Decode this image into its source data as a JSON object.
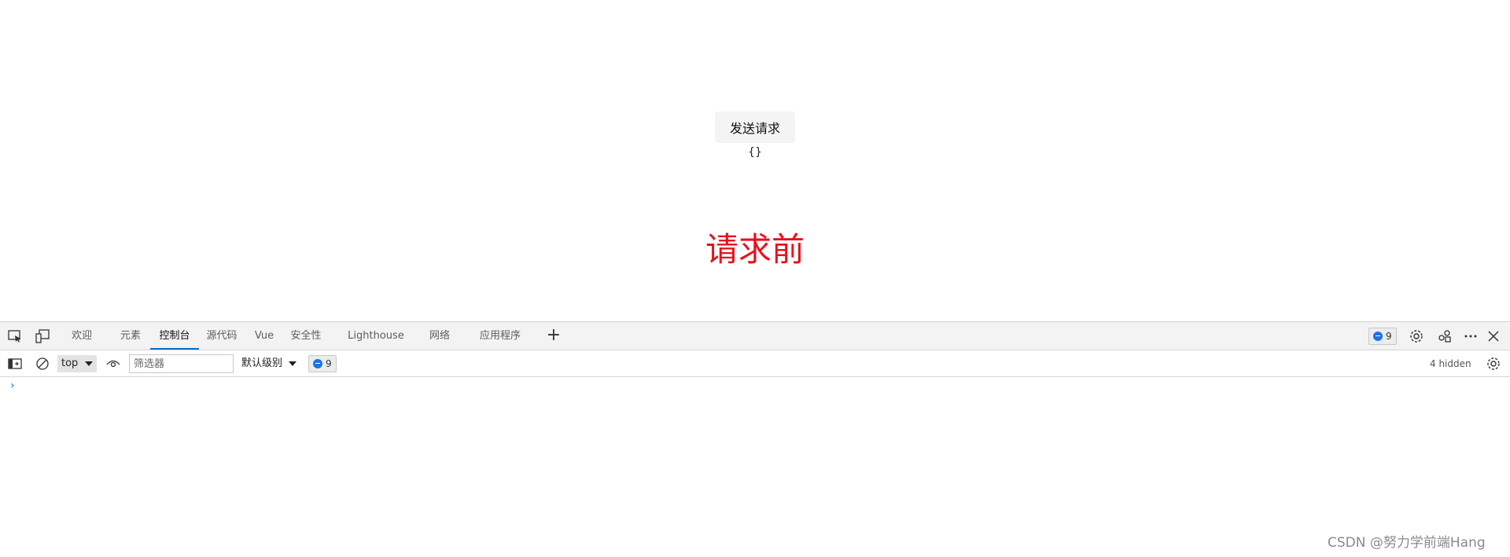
{
  "page": {
    "send_button_label": "发送请求",
    "response_text": "{}",
    "heading": "请求前"
  },
  "devtools": {
    "tabs": [
      {
        "label": "欢迎"
      },
      {
        "label": "元素"
      },
      {
        "label": "控制台"
      },
      {
        "label": "源代码"
      },
      {
        "label": "Vue"
      },
      {
        "label": "安全性"
      },
      {
        "label": "Lighthouse"
      },
      {
        "label": "网络"
      },
      {
        "label": "应用程序"
      }
    ],
    "active_tab": "控制台",
    "issues_count": "9",
    "toolbar": {
      "context": "top",
      "filter_placeholder": "筛选器",
      "level": "默认级别",
      "issues_count": "9",
      "hidden": "4 hidden"
    },
    "prompt_glyph": "›"
  },
  "watermark": "CSDN @努力学前端Hang",
  "colors": {
    "accent": "#0f6cbd",
    "heading": "#e8121d",
    "issue_blue": "#1a73e8"
  },
  "icons": [
    "inspect-icon",
    "device-emulation-icon",
    "add-tab-icon",
    "issues-icon",
    "gear-icon",
    "connect-icon",
    "more-icon",
    "close-icon",
    "sidebar-toggle-icon",
    "clear-console-icon",
    "eye-icon"
  ]
}
